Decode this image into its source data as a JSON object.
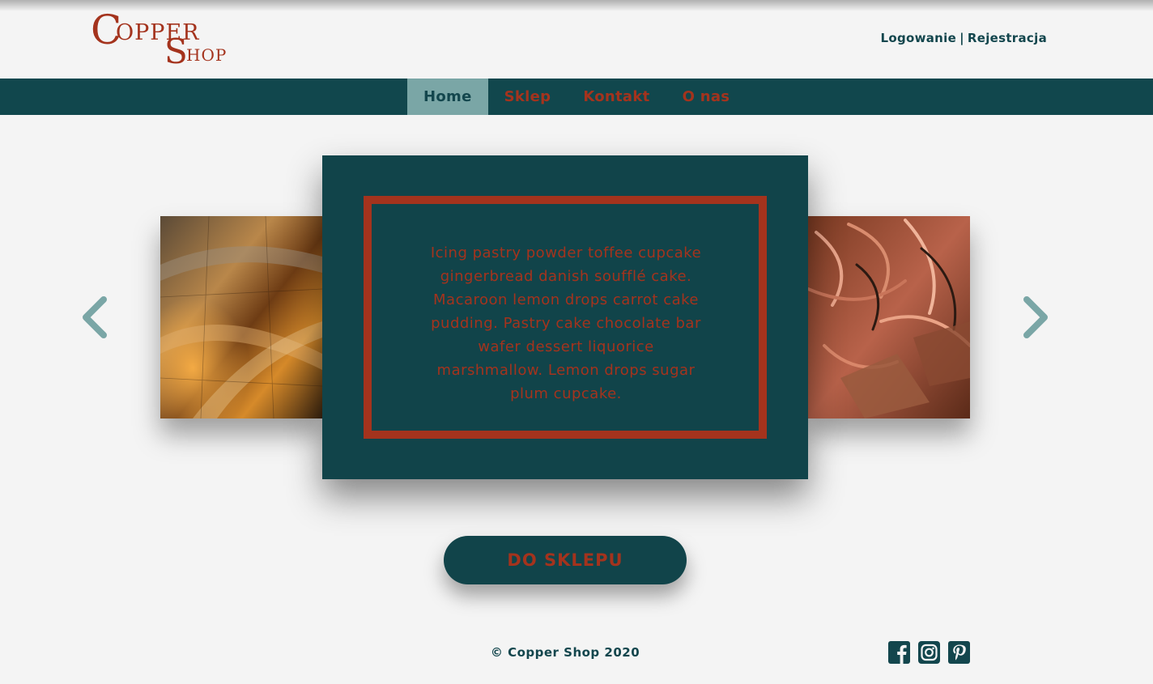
{
  "header": {
    "logo_text": "Copper Shop",
    "logo_parts": {
      "c": "C",
      "opper": "OPPER",
      "s": "S",
      "hop": "HOP"
    },
    "auth": {
      "login": "Logowanie",
      "separator": "|",
      "register": "Rejestracja"
    }
  },
  "nav": {
    "items": [
      {
        "label": "Home",
        "active": true
      },
      {
        "label": "Sklep",
        "active": false
      },
      {
        "label": "Kontakt",
        "active": false
      },
      {
        "label": "O nas",
        "active": false
      }
    ]
  },
  "carousel": {
    "left_icon": "chevron-left-icon",
    "right_icon": "chevron-right-icon",
    "left_image": "copper-sheets-building-photo",
    "right_image": "copper-wire-scraps-photo",
    "card_text": "Icing pastry powder toffee cupcake gingerbread danish soufflé cake. Macaroon lemon drops carrot cake pudding. Pastry cake chocolate bar wafer dessert liquorice marshmallow. Lemon drops sugar plum cupcake."
  },
  "cta": {
    "label": "DO SKLEPU"
  },
  "footer": {
    "copyright": "© Copper Shop 2020",
    "socials": [
      "facebook-icon",
      "instagram-icon",
      "pinterest-icon"
    ]
  },
  "colors": {
    "accent_copper": "#a4331d",
    "dark_teal": "#11474d",
    "muted_teal": "#7aa6a6",
    "background": "#f4f4f4"
  }
}
